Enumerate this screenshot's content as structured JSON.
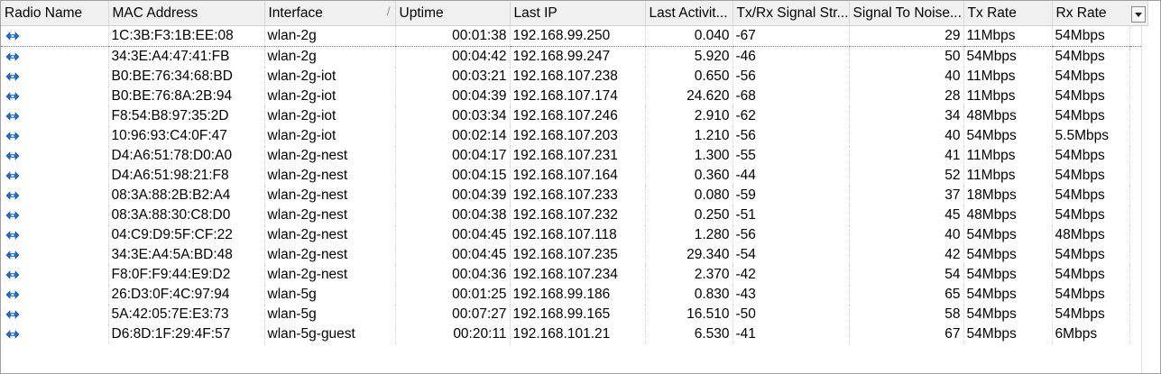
{
  "columns": [
    {
      "label": "Radio Name"
    },
    {
      "label": "MAC Address"
    },
    {
      "label": "Interface",
      "sort": "/"
    },
    {
      "label": "Uptime"
    },
    {
      "label": "Last IP"
    },
    {
      "label": "Last Activit..."
    },
    {
      "label": "Tx/Rx Signal Str..."
    },
    {
      "label": "Signal To Noise..."
    },
    {
      "label": "Tx Rate"
    },
    {
      "label": "Rx Rate"
    }
  ],
  "icon": "wireless-link-icon",
  "accent_color": "#1a6fd0",
  "rows": [
    {
      "mac": "1C:3B:F3:1B:EE:08",
      "iface": "wlan-2g",
      "uptime": "00:01:38",
      "ip": "192.168.99.250",
      "last": "0.040",
      "sig": "-67",
      "snr": "29",
      "tx": "11Mbps",
      "rx": "54Mbps"
    },
    {
      "mac": "34:3E:A4:47:41:FB",
      "iface": "wlan-2g",
      "uptime": "00:04:42",
      "ip": "192.168.99.247",
      "last": "5.920",
      "sig": "-46",
      "snr": "50",
      "tx": "54Mbps",
      "rx": "54Mbps"
    },
    {
      "mac": "B0:BE:76:34:68:BD",
      "iface": "wlan-2g-iot",
      "uptime": "00:03:21",
      "ip": "192.168.107.238",
      "last": "0.650",
      "sig": "-56",
      "snr": "40",
      "tx": "11Mbps",
      "rx": "54Mbps"
    },
    {
      "mac": "B0:BE:76:8A:2B:94",
      "iface": "wlan-2g-iot",
      "uptime": "00:04:39",
      "ip": "192.168.107.174",
      "last": "24.620",
      "sig": "-68",
      "snr": "28",
      "tx": "11Mbps",
      "rx": "54Mbps"
    },
    {
      "mac": "F8:54:B8:97:35:2D",
      "iface": "wlan-2g-iot",
      "uptime": "00:03:34",
      "ip": "192.168.107.246",
      "last": "2.910",
      "sig": "-62",
      "snr": "34",
      "tx": "48Mbps",
      "rx": "54Mbps"
    },
    {
      "mac": "10:96:93:C4:0F:47",
      "iface": "wlan-2g-iot",
      "uptime": "00:02:14",
      "ip": "192.168.107.203",
      "last": "1.210",
      "sig": "-56",
      "snr": "40",
      "tx": "54Mbps",
      "rx": "5.5Mbps"
    },
    {
      "mac": "D4:A6:51:78:D0:A0",
      "iface": "wlan-2g-nest",
      "uptime": "00:04:17",
      "ip": "192.168.107.231",
      "last": "1.300",
      "sig": "-55",
      "snr": "41",
      "tx": "11Mbps",
      "rx": "54Mbps"
    },
    {
      "mac": "D4:A6:51:98:21:F8",
      "iface": "wlan-2g-nest",
      "uptime": "00:04:15",
      "ip": "192.168.107.164",
      "last": "0.360",
      "sig": "-44",
      "snr": "52",
      "tx": "11Mbps",
      "rx": "54Mbps"
    },
    {
      "mac": "08:3A:88:2B:B2:A4",
      "iface": "wlan-2g-nest",
      "uptime": "00:04:39",
      "ip": "192.168.107.233",
      "last": "0.080",
      "sig": "-59",
      "snr": "37",
      "tx": "18Mbps",
      "rx": "54Mbps"
    },
    {
      "mac": "08:3A:88:30:C8:D0",
      "iface": "wlan-2g-nest",
      "uptime": "00:04:38",
      "ip": "192.168.107.232",
      "last": "0.250",
      "sig": "-51",
      "snr": "45",
      "tx": "48Mbps",
      "rx": "54Mbps"
    },
    {
      "mac": "04:C9:D9:5F:CF:22",
      "iface": "wlan-2g-nest",
      "uptime": "00:04:45",
      "ip": "192.168.107.118",
      "last": "1.280",
      "sig": "-56",
      "snr": "40",
      "tx": "54Mbps",
      "rx": "48Mbps"
    },
    {
      "mac": "34:3E:A4:5A:BD:48",
      "iface": "wlan-2g-nest",
      "uptime": "00:04:45",
      "ip": "192.168.107.235",
      "last": "29.340",
      "sig": "-54",
      "snr": "42",
      "tx": "54Mbps",
      "rx": "54Mbps"
    },
    {
      "mac": "F8:0F:F9:44:E9:D2",
      "iface": "wlan-2g-nest",
      "uptime": "00:04:36",
      "ip": "192.168.107.234",
      "last": "2.370",
      "sig": "-42",
      "snr": "54",
      "tx": "54Mbps",
      "rx": "54Mbps"
    },
    {
      "mac": "26:D3:0F:4C:97:94",
      "iface": "wlan-5g",
      "uptime": "00:01:25",
      "ip": "192.168.99.186",
      "last": "0.830",
      "sig": "-43",
      "snr": "65",
      "tx": "54Mbps",
      "rx": "54Mbps"
    },
    {
      "mac": "5A:42:05:7E:E3:73",
      "iface": "wlan-5g",
      "uptime": "00:07:27",
      "ip": "192.168.99.165",
      "last": "16.510",
      "sig": "-50",
      "snr": "58",
      "tx": "54Mbps",
      "rx": "54Mbps"
    },
    {
      "mac": "D6:8D:1F:29:4F:57",
      "iface": "wlan-5g-guest",
      "uptime": "00:20:11",
      "ip": "192.168.101.21",
      "last": "6.530",
      "sig": "-41",
      "snr": "67",
      "tx": "54Mbps",
      "rx": "6Mbps"
    }
  ]
}
